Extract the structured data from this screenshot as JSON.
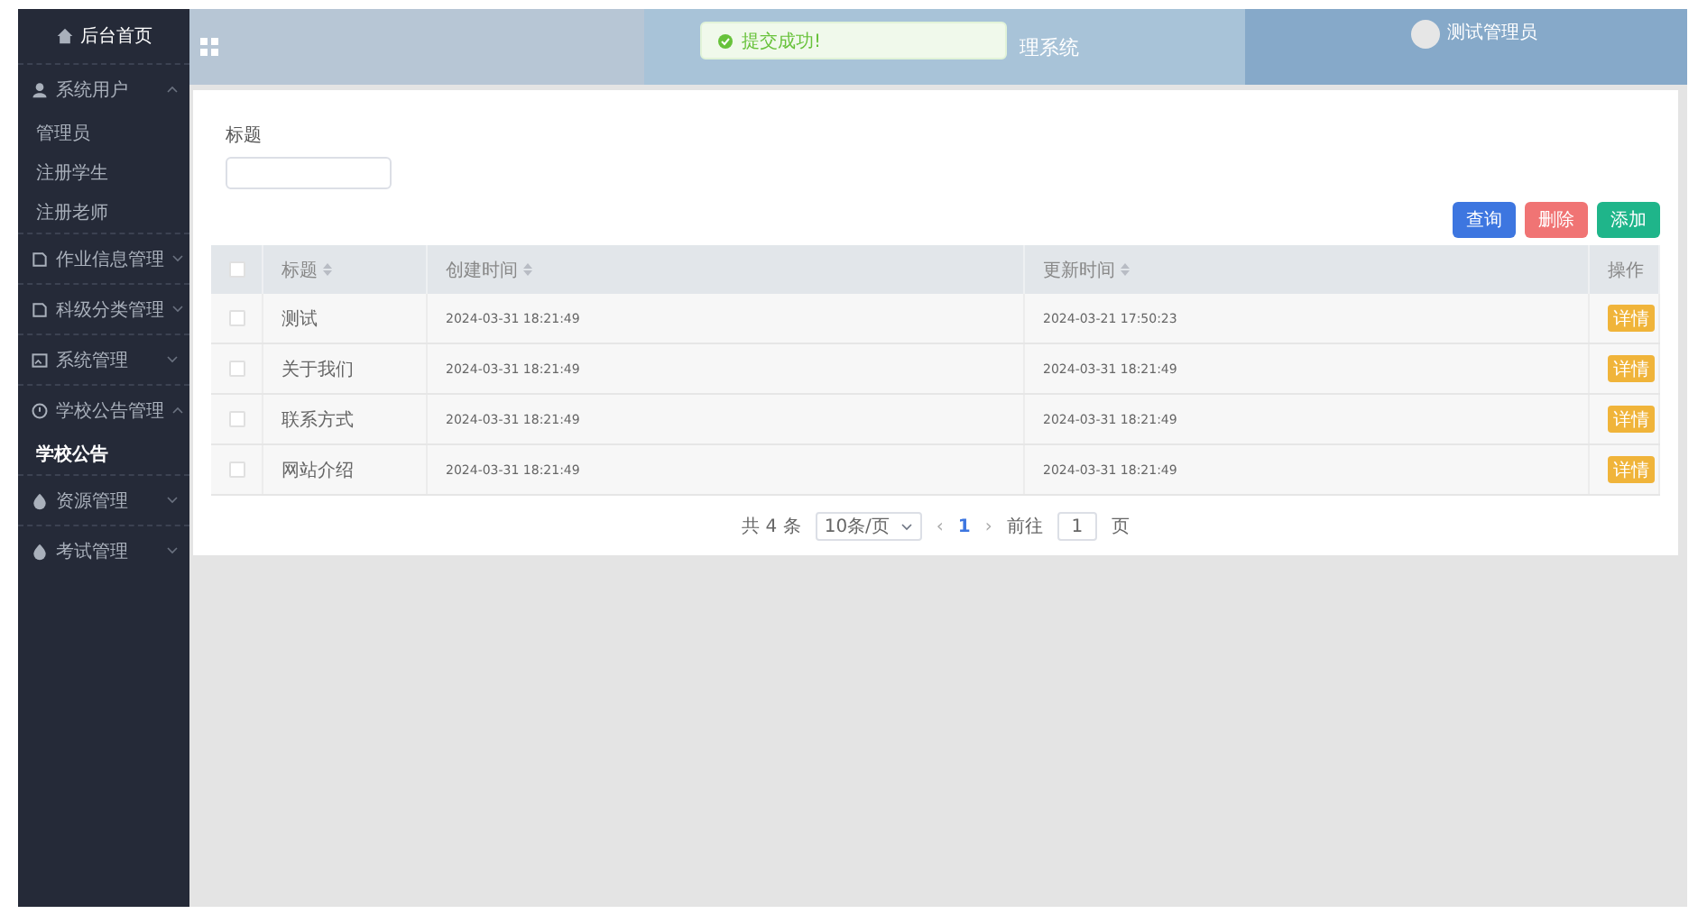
{
  "sidebar": {
    "home": "后台首页",
    "menu": [
      {
        "label": "系统用户",
        "expanded": true,
        "children": [
          {
            "label": "管理员",
            "selected": false
          },
          {
            "label": "注册学生",
            "selected": false
          },
          {
            "label": "注册老师",
            "selected": false
          }
        ]
      },
      {
        "label": "作业信息管理",
        "expanded": false
      },
      {
        "label": "科级分类管理",
        "expanded": false
      },
      {
        "label": "系统管理",
        "expanded": false
      },
      {
        "label": "学校公告管理",
        "expanded": true,
        "children": [
          {
            "label": "学校公告",
            "selected": true
          }
        ]
      },
      {
        "label": "资源管理",
        "expanded": false
      },
      {
        "label": "考试管理",
        "expanded": false
      }
    ]
  },
  "header": {
    "title": "理系统",
    "user": "测试管理员"
  },
  "toast": {
    "message": "提交成功!"
  },
  "search": {
    "label": "标题"
  },
  "buttons": [
    {
      "label": "查询",
      "kind": "primary"
    },
    {
      "label": "删除",
      "kind": "danger"
    },
    {
      "label": "添加",
      "kind": "success"
    }
  ],
  "table": {
    "all_checked": false,
    "columns": [
      {
        "label": "标题",
        "sortable": true
      },
      {
        "label": "创建时间",
        "sortable": true
      },
      {
        "label": "更新时间",
        "sortable": true
      },
      {
        "label": "操作",
        "sortable": false
      }
    ],
    "rows": [
      {
        "checked": false,
        "title": "测试",
        "created": "2024-03-31 18:21:49",
        "updated": "2024-03-21 17:50:23",
        "action": "详情"
      },
      {
        "checked": false,
        "title": "关于我们",
        "created": "2024-03-31 18:21:49",
        "updated": "2024-03-31 18:21:49",
        "action": "详情"
      },
      {
        "checked": false,
        "title": "联系方式",
        "created": "2024-03-31 18:21:49",
        "updated": "2024-03-31 18:21:49",
        "action": "详情"
      },
      {
        "checked": false,
        "title": "网站介绍",
        "created": "2024-03-31 18:21:49",
        "updated": "2024-03-31 18:21:49",
        "action": "详情"
      }
    ]
  },
  "pagination": {
    "total": "共 4 条",
    "page_size": "10条/页",
    "prev": "‹",
    "pages": [
      {
        "label": "1",
        "selected": true
      }
    ],
    "next": "›",
    "goto": "前往",
    "goto_value": "1",
    "goto_suffix": "页"
  }
}
